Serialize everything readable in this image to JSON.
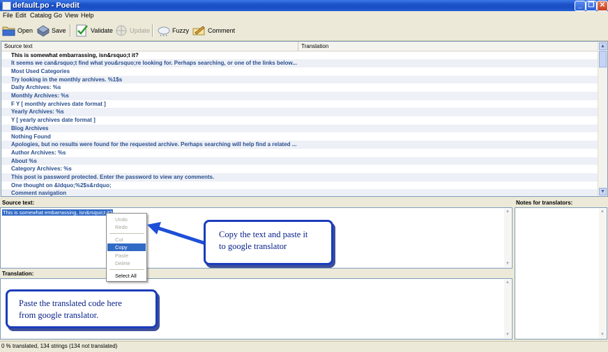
{
  "window": {
    "title": "default.po - Poedit"
  },
  "menu": [
    "File",
    "Edit",
    "Catalog",
    "Go",
    "View",
    "Help"
  ],
  "toolbar": {
    "open": "Open",
    "save": "Save",
    "validate": "Validate",
    "update": "Update",
    "fuzzy": "Fuzzy",
    "comment": "Comment"
  },
  "list": {
    "columns": {
      "source": "Source text",
      "translation": "Translation"
    },
    "rows": [
      "This is somewhat embarrassing, isn&rsquo;t it?",
      "It seems we can&rsquo;t find what you&rsquo;re looking for. Perhaps searching, or one of the links below...",
      "Most Used Categories",
      "Try looking in the monthly archives. %1$s",
      "Daily Archives: %s",
      "Monthly Archives: %s",
      "F Y  [ monthly archives date format ]",
      "Yearly Archives: %s",
      "Y  [ yearly archives date format ]",
      "Blog Archives",
      "Nothing Found",
      "Apologies, but no results were found for the requested archive. Perhaps searching will help find a related ...",
      "Author Archives: %s",
      "About %s",
      "Category Archives: %s",
      "This post is password protected. Enter the password to view any comments.",
      "One thought on &ldquo;%2$s&rdquo;",
      "Comment navigation"
    ]
  },
  "editor": {
    "source_label": "Source text:",
    "source_value": "This is somewhat embarrassing, isn&rsquo;t it?",
    "translation_label": "Translation:",
    "notes_label": "Notes for translators:"
  },
  "context_menu": {
    "undo": "Undo",
    "redo": "Redo",
    "cut": "Cut",
    "copy": "Copy",
    "paste": "Paste",
    "delete": "Delete",
    "select_all": "Select All"
  },
  "callouts": {
    "copy_line1": "Copy the text and paste it",
    "copy_line2": "to google translator",
    "paste_line1": "Paste the translated code here",
    "paste_line2": "from google translator."
  },
  "status": {
    "text": "0 % translated, 134 strings (134 not translated)"
  },
  "colors": {
    "callout_border": "#1b3cbb",
    "arrow": "#1f4fd8",
    "row_text": "#2a4f8f",
    "selection": "#316ac5"
  }
}
